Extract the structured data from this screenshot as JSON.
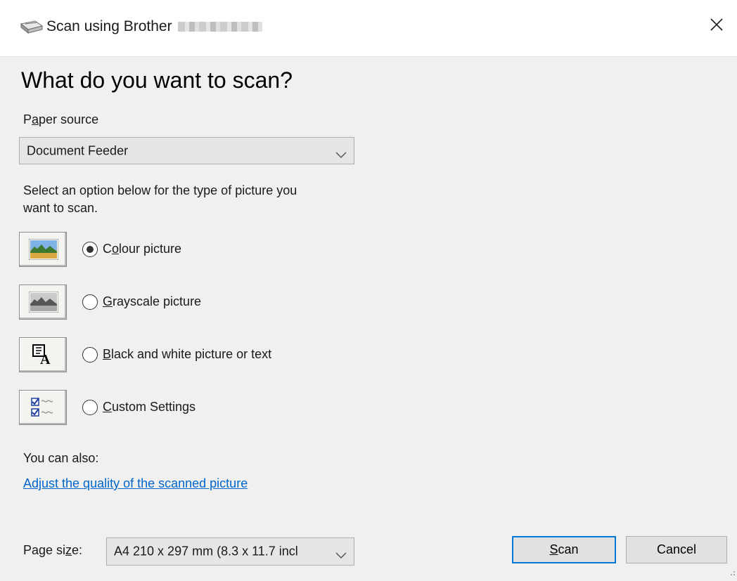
{
  "window": {
    "title": "Scan using Brother",
    "title_model_redacted": true,
    "title_icon": "scanner-icon",
    "close_icon": "close-icon"
  },
  "heading": "What do you want to scan?",
  "paper_source": {
    "label": "Paper source",
    "value": "Document Feeder"
  },
  "instructions": [
    "Select an option below for the type of picture you",
    "want to scan."
  ],
  "options": [
    {
      "label": "Colour picture",
      "selected": true,
      "icon": "colour-picture-icon"
    },
    {
      "label": "Grayscale picture",
      "selected": false,
      "icon": "grayscale-picture-icon"
    },
    {
      "label": "Black and white picture or text",
      "selected": false,
      "icon": "black-white-picture-icon"
    },
    {
      "label": "Custom Settings",
      "selected": false,
      "icon": "custom-settings-icon"
    }
  ],
  "also_label": "You can also:",
  "adjust_link": "Adjust the quality of the scanned picture",
  "page_size": {
    "label": "Page size:",
    "value": "A4 210 x 297 mm (8.3 x 11.7 incl"
  },
  "buttons": {
    "scan": "Scan",
    "cancel": "Cancel"
  },
  "colors": {
    "accent": "#0078d7",
    "link": "#0066cc",
    "background": "#f0f0f0"
  }
}
